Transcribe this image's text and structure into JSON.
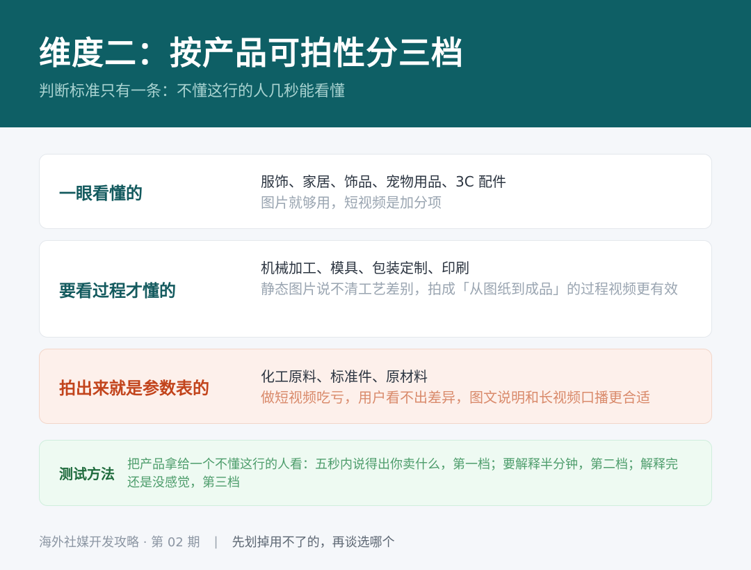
{
  "header": {
    "title": "维度二：按产品可拍性分三档",
    "subtitle": "判断标准只有一条：不懂这行的人几秒能看懂"
  },
  "tiers": [
    {
      "label": "一眼看懂的",
      "items": "服饰、家居、饰品、宠物用品、3C 配件",
      "note": "图片就够用，短视频是加分项"
    },
    {
      "label": "要看过程才懂的",
      "items": "机械加工、模具、包装定制、印刷",
      "note": "静态图片说不清工艺差别，拍成「从图纸到成品」的过程视频更有效"
    },
    {
      "label": "拍出来就是参数表的",
      "items": "化工原料、标准件、原材料",
      "note": "做短视频吃亏，用户看不出差异，图文说明和长视频口播更合适"
    }
  ],
  "test": {
    "label": "测试方法",
    "text": "把产品拿给一个不懂这行的人看：五秒内说得出你卖什么，第一档；要解释半分钟，第二档；解释完还是没感觉，第三档"
  },
  "footer": {
    "series": "海外社媒开发攻略 · 第 02 期",
    "separator": "|",
    "tagline": "先划掉用不了的，再谈选哪个"
  }
}
